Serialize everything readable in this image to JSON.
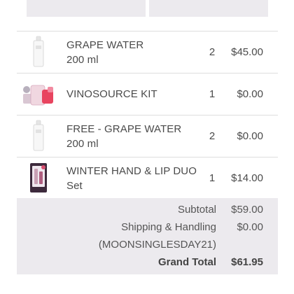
{
  "items": [
    {
      "name_line1": "GRAPE WATER",
      "name_line2": "200 ml",
      "qty": "2",
      "price": "$45.00",
      "icon": "spray-bottle-icon"
    },
    {
      "name_line1": "VINOSOURCE KIT",
      "name_line2": "",
      "qty": "1",
      "price": "$0.00",
      "icon": "kit-icon"
    },
    {
      "name_line1": "FREE - GRAPE WATER",
      "name_line2": "200 ml",
      "qty": "2",
      "price": "$0.00",
      "icon": "spray-bottle-icon"
    },
    {
      "name_line1": "WINTER HAND & LIP DUO",
      "name_line2": "Set",
      "qty": "1",
      "price": "$14.00",
      "icon": "gift-set-icon"
    }
  ],
  "totals": {
    "subtotal_label": "Subtotal",
    "subtotal_value": "$59.00",
    "shipping_label": "Shipping & Handling",
    "shipping_value": "$0.00",
    "promo_code": "(MOONSINGLESDAY21)",
    "grand_total_label": "Grand Total",
    "grand_total_value": "$61.95"
  },
  "colors": {
    "panel_gray": "#eceaee",
    "text": "#4a4a4a",
    "divider": "#dddddd"
  }
}
